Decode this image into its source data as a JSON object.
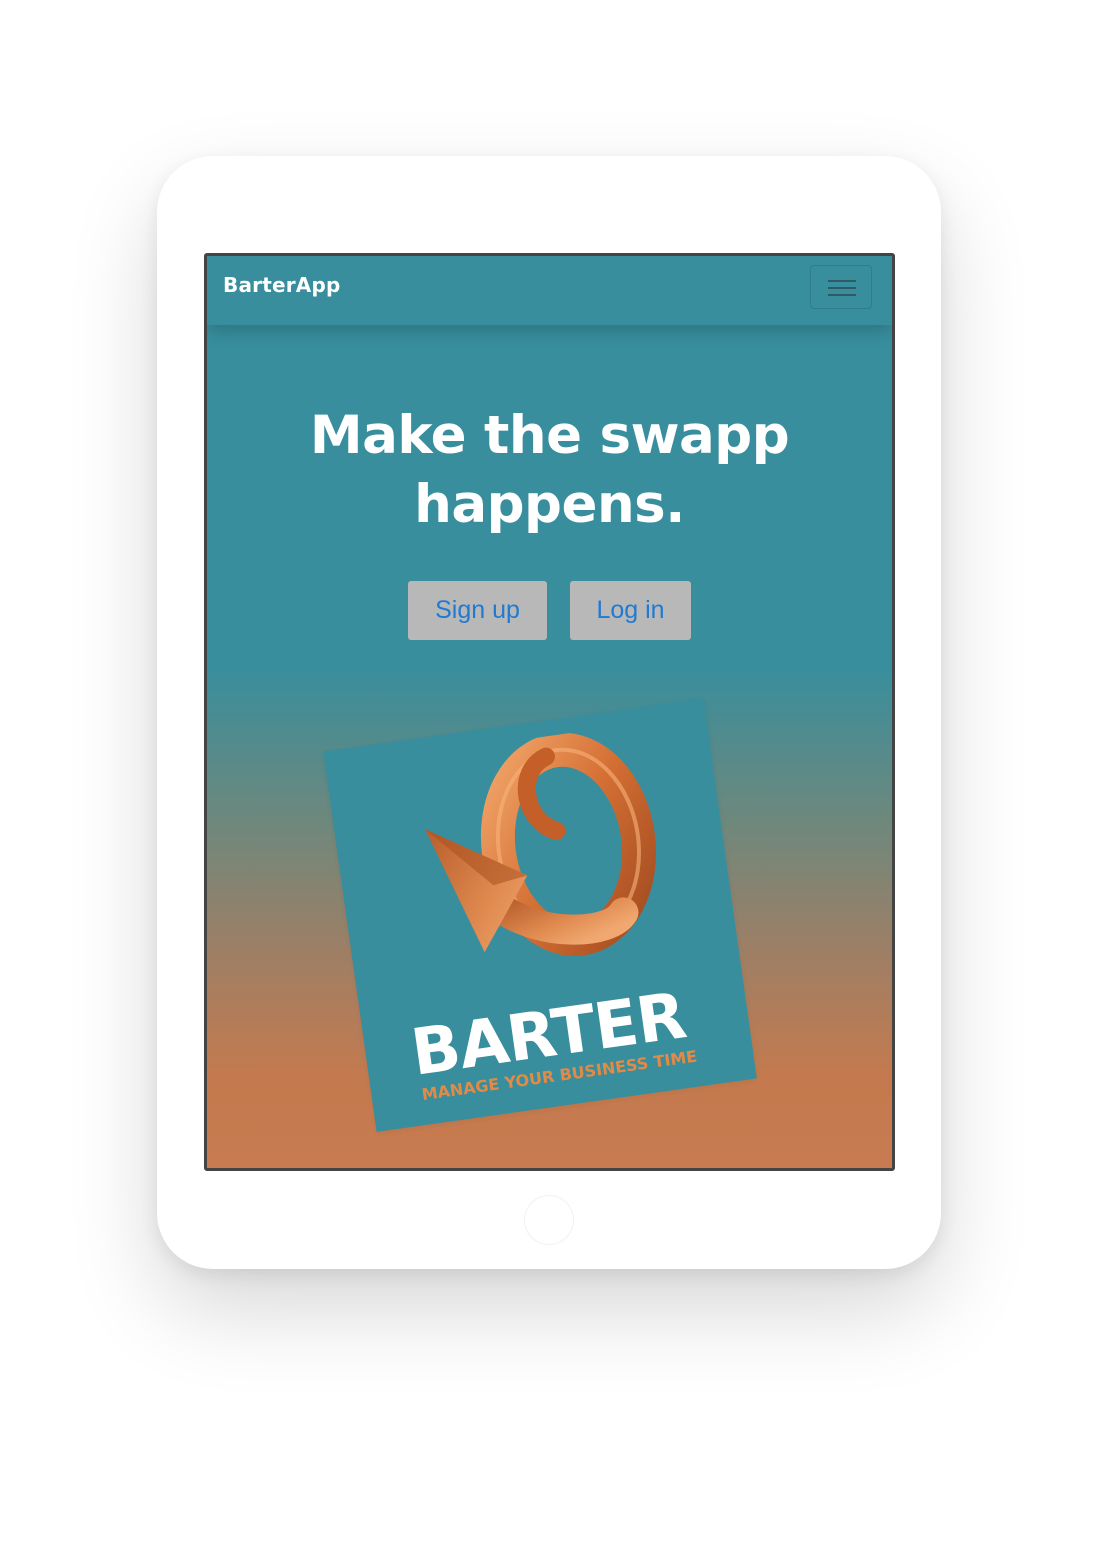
{
  "navbar": {
    "brand": "BarterApp",
    "menu_icon": "hamburger-menu-icon"
  },
  "hero": {
    "headline_line1": "Make the swapp",
    "headline_line2": "happens.",
    "signup_label": "Sign up",
    "login_label": "Log in"
  },
  "logo": {
    "icon": "swirl-arrow-icon",
    "wordmark": "BARTER",
    "tagline": "MANAGE YOUR BUSINESS TIME"
  },
  "colors": {
    "navbar": "#388e9d",
    "gradient_top": "#388e9d",
    "gradient_bottom": "#c87b50",
    "button_bg": "#b8b8b8",
    "button_text": "#1f7ad2",
    "logo_accent": "#d1703a"
  }
}
